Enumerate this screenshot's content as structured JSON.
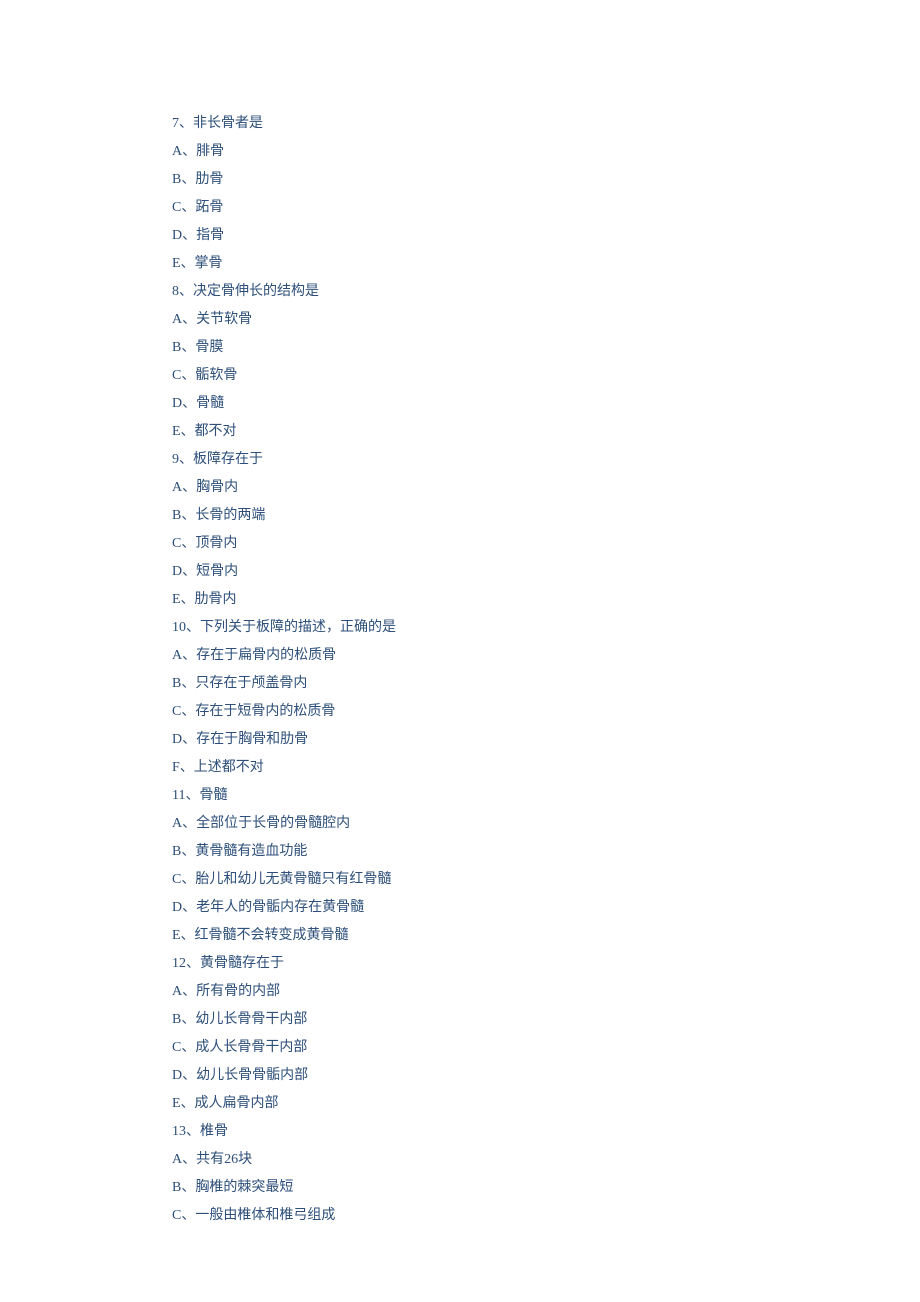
{
  "lines": [
    "7、非长骨者是",
    "A、腓骨",
    "B、肋骨",
    "C、跖骨",
    "D、指骨",
    "E、掌骨",
    "8、决定骨伸长的结构是",
    "A、关节软骨",
    "B、骨膜",
    "C、骺软骨",
    "D、骨髓",
    "E、都不对",
    "9、板障存在于",
    "A、胸骨内",
    "B、长骨的两端",
    "C、顶骨内",
    "D、短骨内",
    "E、肋骨内",
    "10、下列关于板障的描述，正确的是",
    "A、存在于扁骨内的松质骨",
    "B、只存在于颅盖骨内",
    "C、存在于短骨内的松质骨",
    "D、存在于胸骨和肋骨",
    "F、上述都不对",
    "11、骨髓",
    "A、全部位于长骨的骨髓腔内",
    "B、黄骨髓有造血功能",
    "C、胎儿和幼儿无黄骨髓只有红骨髓",
    "D、老年人的骨骺内存在黄骨髓",
    "E、红骨髓不会转变成黄骨髓",
    "12、黄骨髓存在于",
    "A、所有骨的内部",
    "B、幼儿长骨骨干内部",
    "C、成人长骨骨干内部",
    "D、幼儿长骨骨骺内部",
    "E、成人扁骨内部",
    "13、椎骨",
    "A、共有26块",
    "B、胸椎的棘突最短",
    "C、一般由椎体和椎弓组成"
  ]
}
